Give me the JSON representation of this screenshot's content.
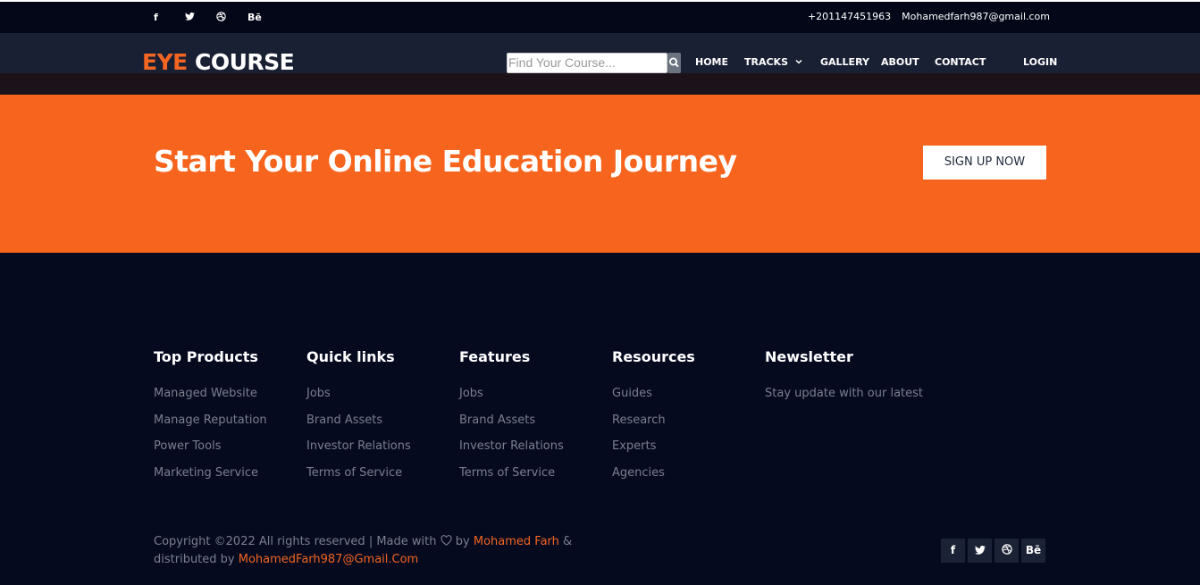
{
  "topbar": {
    "socials": [
      "f",
      "t",
      "dribbble",
      "Bē"
    ],
    "phone": "+201147451963",
    "email": "Mohamedfarh987@gmail.com"
  },
  "brand": {
    "part1": "EYE",
    "part2": "COURSE",
    "accent": "#f26522"
  },
  "search": {
    "placeholder": "Find Your Course..."
  },
  "nav": {
    "home": "HOME",
    "tracks": "TRACKS",
    "gallery": "GALLERY",
    "about": "ABOUT",
    "contact": "CONTACT",
    "login": "LOGIN"
  },
  "cta": {
    "title": "Start Your Online Education Journey",
    "button": "SIGN UP NOW",
    "bg": "#f7641d"
  },
  "footer": {
    "col1": {
      "title": "Top Products",
      "items": [
        "Managed Website",
        "Manage Reputation",
        "Power Tools",
        "Marketing Service"
      ]
    },
    "col2": {
      "title": "Quick links",
      "items": [
        "Jobs",
        "Brand Assets",
        "Investor Relations",
        "Terms of Service"
      ]
    },
    "col3": {
      "title": "Features",
      "items": [
        "Jobs",
        "Brand Assets",
        "Investor Relations",
        "Terms of Service"
      ]
    },
    "col4": {
      "title": "Resources",
      "items": [
        "Guides",
        "Research",
        "Experts",
        "Agencies"
      ]
    },
    "col5": {
      "title": "Newsletter",
      "text": "Stay update with our latest"
    }
  },
  "copyright": {
    "prefix": "Copyright ©2022 All rights reserved | Made with",
    "by": "by",
    "author": "Mohamed Farh",
    "amp": "&",
    "distributed": "distributed by",
    "email": "MohamedFarh987@Gmail.Com"
  }
}
